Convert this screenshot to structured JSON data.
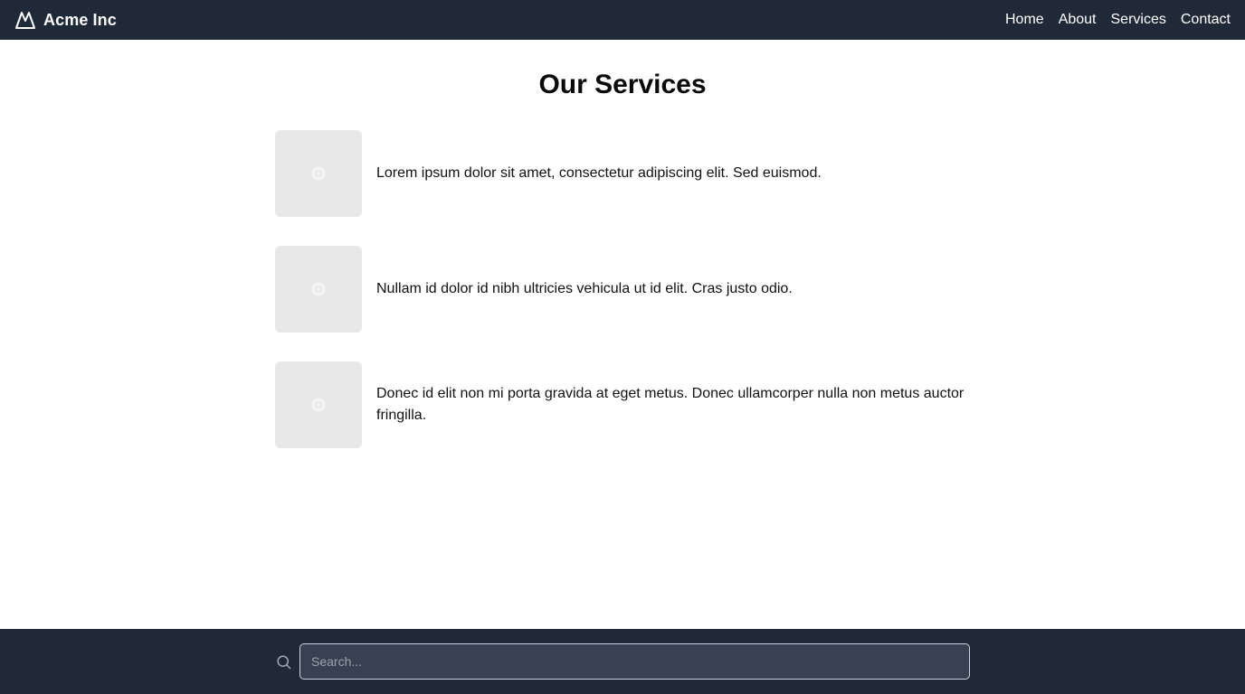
{
  "header": {
    "brand_name": "Acme Inc",
    "brand_icon": "mountain-icon",
    "nav": [
      {
        "label": "Home"
      },
      {
        "label": "About"
      },
      {
        "label": "Services"
      },
      {
        "label": "Contact"
      }
    ]
  },
  "main": {
    "title": "Our Services",
    "services": [
      {
        "text": "Lorem ipsum dolor sit amet, consectetur adipiscing elit. Sed euismod.",
        "image_icon": "placeholder-image-icon"
      },
      {
        "text": "Nullam id dolor id nibh ultricies vehicula ut id elit. Cras justo odio.",
        "image_icon": "placeholder-image-icon"
      },
      {
        "text": "Donec id elit non mi porta gravida at eget metus. Donec ullamcorper nulla non metus auctor fringilla.",
        "image_icon": "placeholder-image-icon"
      }
    ]
  },
  "footer": {
    "search": {
      "placeholder": "Search...",
      "value": ""
    }
  },
  "colors": {
    "header_bg": "#1f2937",
    "footer_bg": "#1f2937",
    "input_bg": "#374151",
    "thumb_bg": "#e8e8e8",
    "text": "#111111"
  }
}
